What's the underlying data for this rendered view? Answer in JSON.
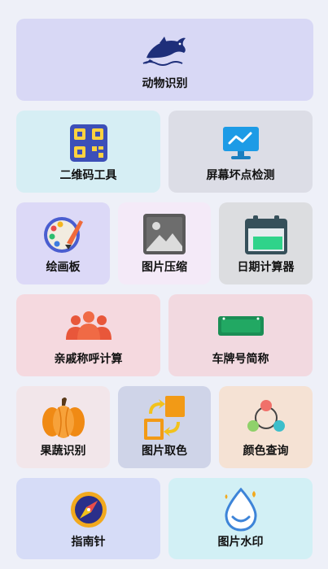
{
  "tiles": {
    "animal": {
      "label": "动物识别",
      "icon": "dolphin-icon",
      "bg": "#d8d8f5"
    },
    "qr": {
      "label": "二维码工具",
      "icon": "qr-code-icon",
      "bg": "#d6eef4"
    },
    "pixel": {
      "label": "屏幕坏点检测",
      "icon": "monitor-icon",
      "bg": "#dcdde6"
    },
    "draw": {
      "label": "绘画板",
      "icon": "palette-icon",
      "bg": "#dcd9f7"
    },
    "compress": {
      "label": "图片压缩",
      "icon": "image-icon",
      "bg": "#f4eaf8"
    },
    "date": {
      "label": "日期计算器",
      "icon": "calendar-icon",
      "bg": "#dcdde0"
    },
    "kin": {
      "label": "亲戚称呼计算",
      "icon": "people-icon",
      "bg": "#f5d9df"
    },
    "plate": {
      "label": "车牌号简称",
      "icon": "license-plate-icon",
      "bg": "#f2d9e0"
    },
    "fruit": {
      "label": "果蔬识别",
      "icon": "pumpkin-icon",
      "bg": "#f2e6ea"
    },
    "pick": {
      "label": "图片取色",
      "icon": "color-picker-icon",
      "bg": "#cfd4e8"
    },
    "color": {
      "label": "颜色查询",
      "icon": "color-nodes-icon",
      "bg": "#f5e2d4"
    },
    "compass": {
      "label": "指南针",
      "icon": "compass-icon",
      "bg": "#d6dcf7"
    },
    "watermark": {
      "label": "图片水印",
      "icon": "water-drop-icon",
      "bg": "#d2f0f5"
    }
  }
}
